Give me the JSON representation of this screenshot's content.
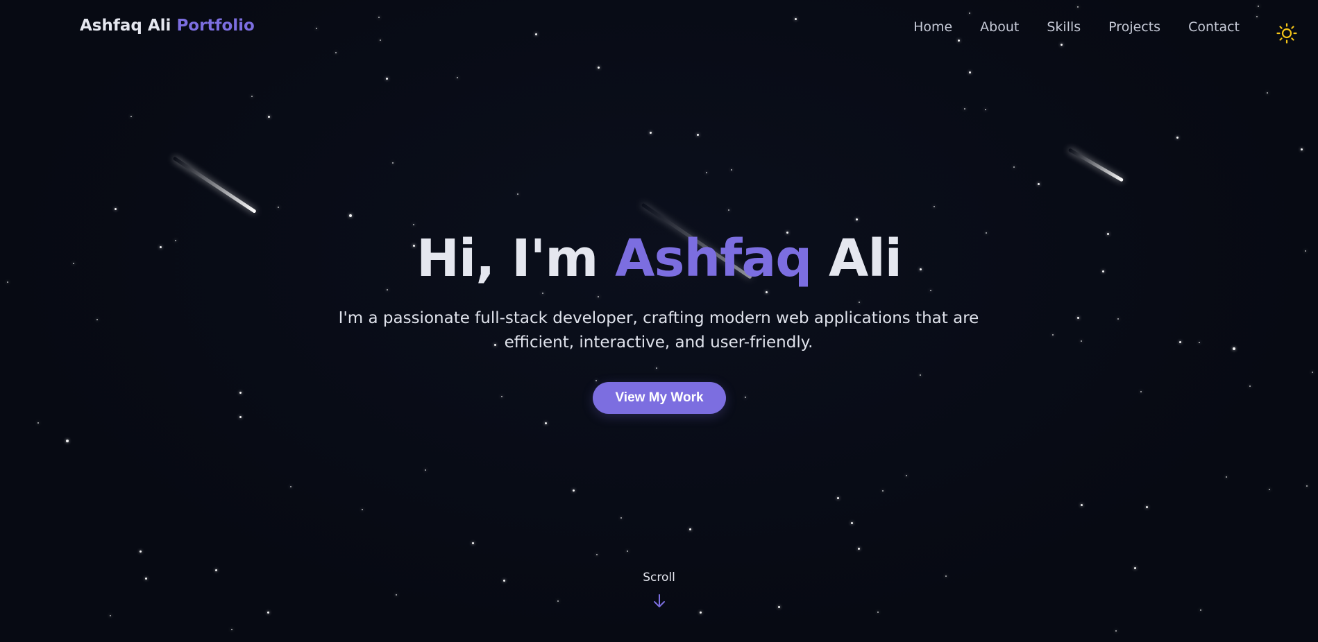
{
  "brand": {
    "name": "Ashfaq Ali",
    "accent": "Portfolio"
  },
  "nav": {
    "items": [
      {
        "label": "Home"
      },
      {
        "label": "About"
      },
      {
        "label": "Skills"
      },
      {
        "label": "Projects"
      },
      {
        "label": "Contact"
      }
    ],
    "theme_toggle_icon": "sun-icon"
  },
  "hero": {
    "greeting": "Hi, I'm",
    "first_name": "Ashfaq",
    "last_name": "Ali",
    "subtitle": "I'm a passionate full-stack developer, crafting modern web applications that are efficient, interactive, and user-friendly.",
    "cta_label": "View My Work"
  },
  "scroll": {
    "label": "Scroll",
    "icon": "arrow-down-icon"
  },
  "colors": {
    "background": "#070a13",
    "accent": "#7c6ee0",
    "text": "#e5e7ef",
    "sun": "#f5c518"
  }
}
